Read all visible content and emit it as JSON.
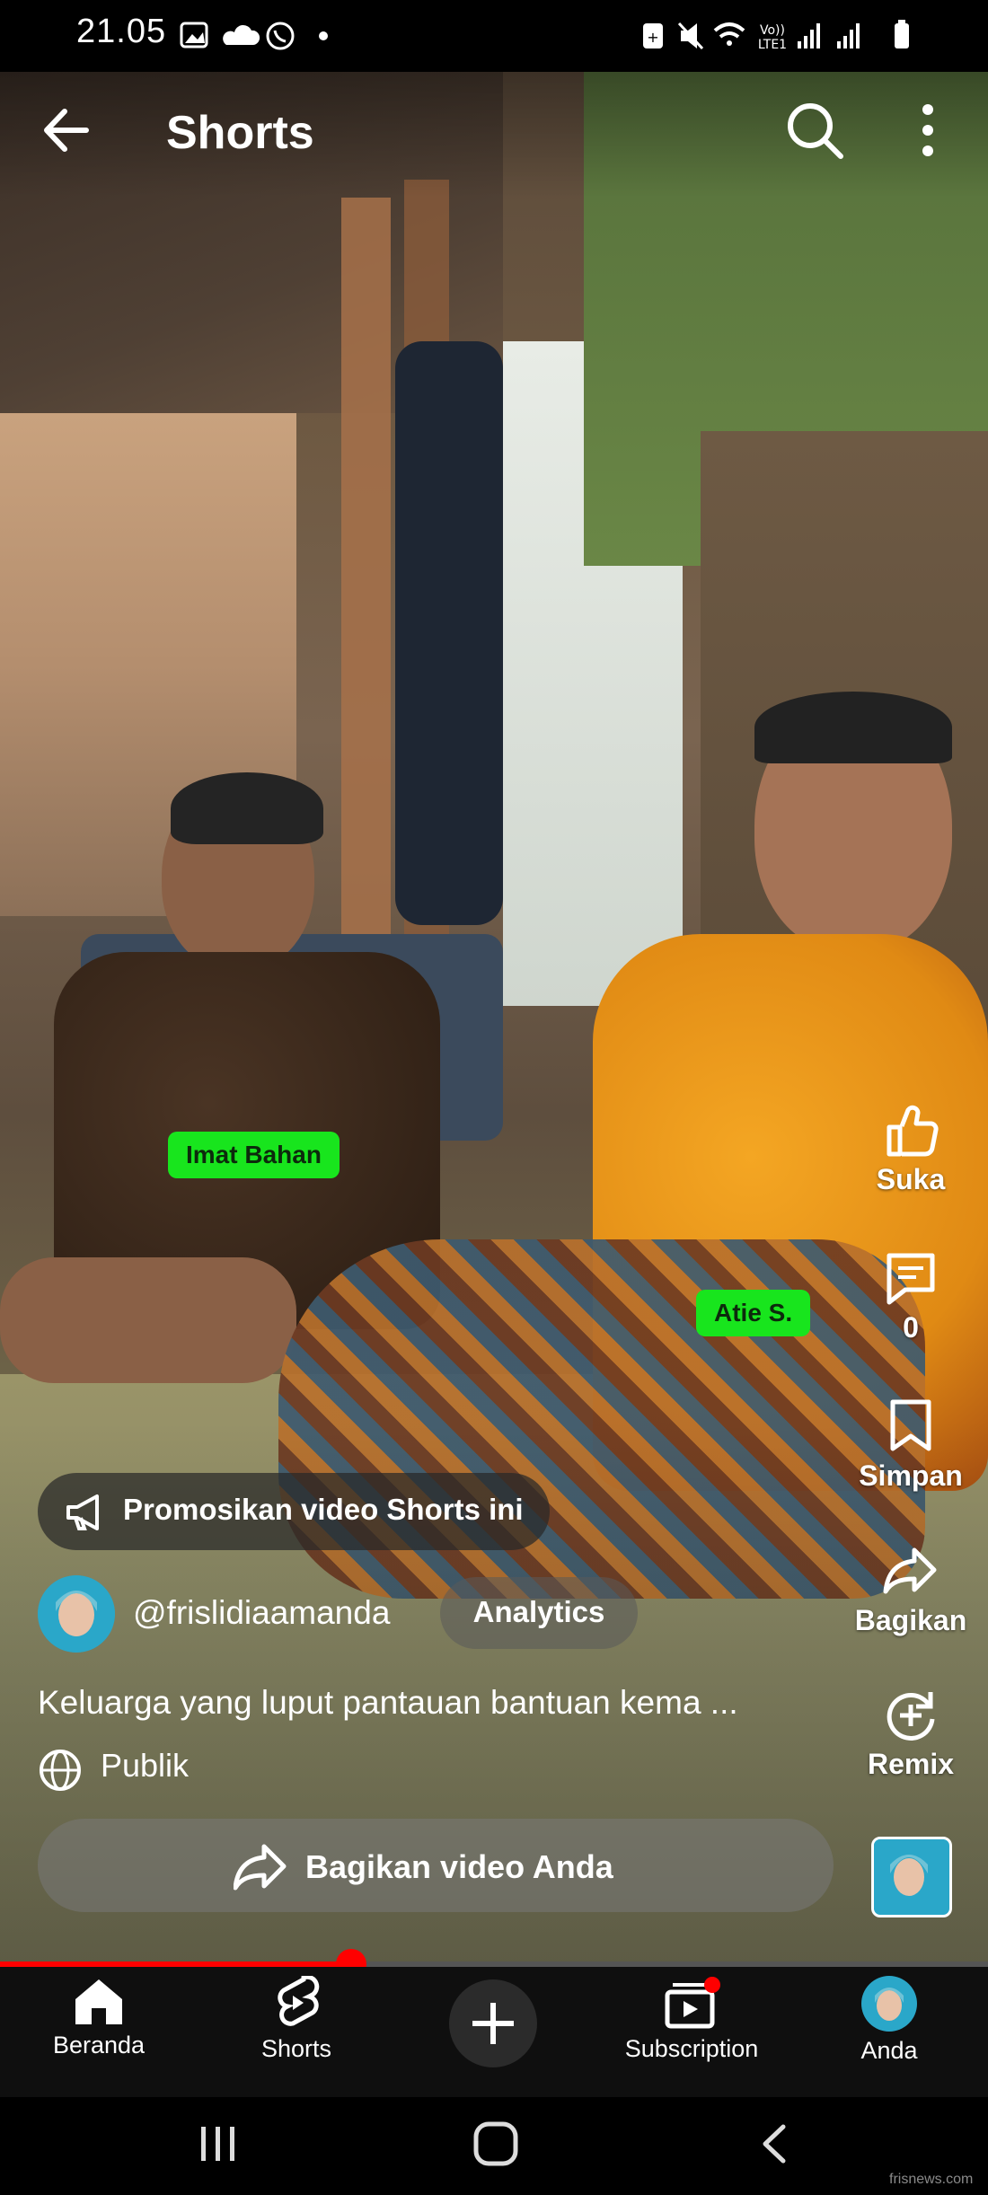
{
  "status_bar": {
    "time": "21.05",
    "icons": [
      "gallery-icon",
      "cloud-icon",
      "whatsapp-icon",
      "dot-icon",
      "battery-saver-icon",
      "mute-icon",
      "wifi-icon",
      "volte-icon",
      "signal-icon",
      "signal-icon",
      "battery-icon"
    ],
    "volte_label": "Vo)) LTE1"
  },
  "header": {
    "title": "Shorts",
    "back_icon": "arrow-left-icon",
    "search_icon": "search-icon",
    "more_icon": "more-vertical-icon"
  },
  "video": {
    "name_tags": [
      "Imat Bahan",
      "Atie S."
    ]
  },
  "side_actions": [
    {
      "icon": "thumbs-up-icon",
      "label": "Suka"
    },
    {
      "icon": "comment-icon",
      "label": "0"
    },
    {
      "icon": "bookmark-icon",
      "label": "Simpan"
    },
    {
      "icon": "share-icon",
      "label": "Bagikan"
    },
    {
      "icon": "remix-icon",
      "label": "Remix"
    }
  ],
  "promote": {
    "icon": "megaphone-icon",
    "label": "Promosikan video Shorts ini"
  },
  "channel": {
    "handle": "@frislidiaamanda",
    "analytics_label": "Analytics"
  },
  "caption": "Keluarga yang luput pantauan bantuan  kema ...",
  "visibility": {
    "icon": "globe-icon",
    "label": "Publik"
  },
  "share_bar": {
    "icon": "share-icon",
    "label": "Bagikan video Anda"
  },
  "progress": {
    "fraction": 0.355,
    "color": "#ff0000"
  },
  "bottom_nav": [
    {
      "icon": "home-icon",
      "label": "Beranda"
    },
    {
      "icon": "shorts-icon",
      "label": "Shorts"
    },
    {
      "icon": "plus-icon",
      "label": ""
    },
    {
      "icon": "subscription-icon",
      "label": "Subscription"
    },
    {
      "icon": "avatar-icon",
      "label": "Anda"
    }
  ],
  "watermark": "frisnews.com",
  "colors": {
    "name_tag": "#18e51d",
    "accent_red": "#ff0000",
    "nav_bg": "#0f0f0f"
  }
}
